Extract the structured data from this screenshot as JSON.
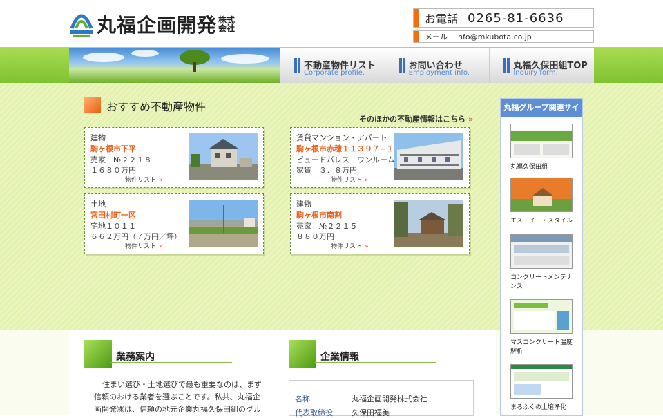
{
  "header": {
    "logo_text": "丸福企画開発",
    "logo_sub_1": "株式",
    "logo_sub_2": "会社",
    "phone_label": "お電話",
    "phone_number": "0265-81-6636",
    "mail_label": "メール",
    "mail_address": "info@mkubota.co.jp"
  },
  "nav": [
    {
      "jp": "不動産物件リスト",
      "en": "Corporate profile."
    },
    {
      "jp": "お問い合わせ",
      "en": "Employment info."
    },
    {
      "jp": "丸福久保田組TOP",
      "en": "Inquiry form."
    }
  ],
  "featured": {
    "title": "おすすめ不動産物件",
    "more_link": "そのほかの不動産情報はこちら",
    "cards": [
      {
        "type": "建物",
        "location": "駒ヶ根市下平",
        "line3": "売家　№２２１８",
        "line4": "１６８０万円",
        "link": "物件リスト"
      },
      {
        "type": "賃貸マンション・アパート",
        "location": "駒ヶ根市赤穂１１３９７−１",
        "line3": "ビュードパレス　ワンルーム",
        "line4": "家賃　３．８万円",
        "link": "物件リスト"
      },
      {
        "type": "土地",
        "location": "宮田村町一区",
        "line3": "宅地１０１１",
        "line4": "６６２万円（７万円／坪）",
        "link": "物件リスト"
      },
      {
        "type": "建物",
        "location": "駒ヶ根市南割",
        "line3": "売家　№２２１５",
        "line4": "８８０万円",
        "link": "物件リスト"
      }
    ]
  },
  "sidebar": {
    "title": "丸福グループ関連サイト",
    "items": [
      {
        "caption": "丸福久保田組"
      },
      {
        "caption": "エス・イー・スタイル"
      },
      {
        "caption": "コンクリートメンテナンス"
      },
      {
        "caption": "マスコンクリート温度解析"
      },
      {
        "caption": "まるふくの土壌浄化"
      }
    ]
  },
  "business": {
    "title": "業務案内",
    "text": "住まい選び・土地選びで最も重要なのは、まず信頼のおける業者を選ぶことです。私共、丸福企画開発㈱は、信頼の地元企業丸福久保田組のグル"
  },
  "company": {
    "title": "企業情報",
    "rows": [
      {
        "key": "名称",
        "value": "丸福企画開発株式会社"
      },
      {
        "key": "代表取締役",
        "value": "久保田福美"
      }
    ]
  },
  "colors": {
    "accent_orange": "#f07010",
    "nav_blue": "#5b8fd6",
    "band_green": "#8fcf3c"
  }
}
